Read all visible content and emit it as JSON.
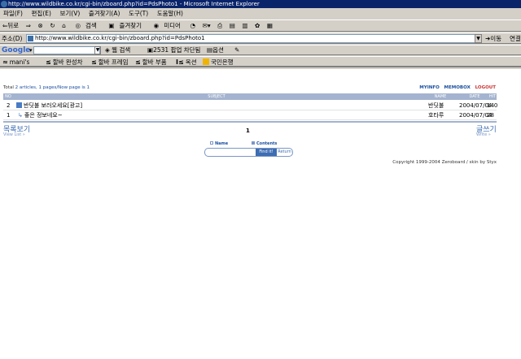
{
  "window": {
    "title": "http://www.wildbike.co.kr/cgi-bin/zboard.php?id=PdsPhoto1 - Microsoft Internet Explorer"
  },
  "menu": [
    "파일(F)",
    "편집(E)",
    "보기(V)",
    "즐겨찾기(A)",
    "도구(T)",
    "도움말(H)"
  ],
  "toolbar": {
    "back": "⇐뒤로",
    "forward": "⇒",
    "search": "검색",
    "favorites": "즐겨찾기",
    "media": "미디어"
  },
  "address": {
    "label": "주소(D)",
    "url": "http://www.wildbike.co.kr/cgi-bin/zboard.php?id=PdsPhoto1",
    "go": "이동",
    "links": "연결"
  },
  "google": {
    "logo": "Google",
    "web_search": "웹 검색",
    "popups": "2531 팝업 차단됨",
    "options": "옵션"
  },
  "links_bar": [
    {
      "mark": "≈",
      "label": "mani's"
    },
    {
      "mark": "≤",
      "label": "할바 완성차"
    },
    {
      "mark": "≤",
      "label": "할바 프레임"
    },
    {
      "mark": "≤",
      "label": "할바 부품"
    },
    {
      "mark": "I≤",
      "label": "옥션"
    },
    {
      "mark": "",
      "label": "국민은행"
    }
  ],
  "board": {
    "total_label": "Total",
    "articles": "2 articles,",
    "pages": "1 pages/Now page is",
    "page_now": "1",
    "myinfo": "MYINFO",
    "memobox": "MEMOBOX",
    "logout": "LOGOUT",
    "columns": {
      "no": "NO",
      "subject": "SUBJECT",
      "name": "NAME",
      "date": "DATE",
      "hit": "HIT"
    },
    "rows": [
      {
        "no": "2",
        "subject": "반딧불 보러오세요[광고]",
        "name": "반딧불",
        "date": "2004/07/04",
        "hit": "140"
      },
      {
        "no": "1",
        "subject": "좋은 정보네요~",
        "name": "호타루",
        "date": "2004/07/04",
        "hit": "28"
      }
    ],
    "list_label": "목록보기",
    "list_sub": "View List »",
    "page_number": "1",
    "write_label": "글쓰기",
    "write_sub": "Write »",
    "search_name": "Name",
    "search_contents": "Contents",
    "find_btn": "Find it!",
    "return_btn": "Return",
    "copyright": "Copyright 1999-2004 Zeroboard / skin by Styx"
  }
}
